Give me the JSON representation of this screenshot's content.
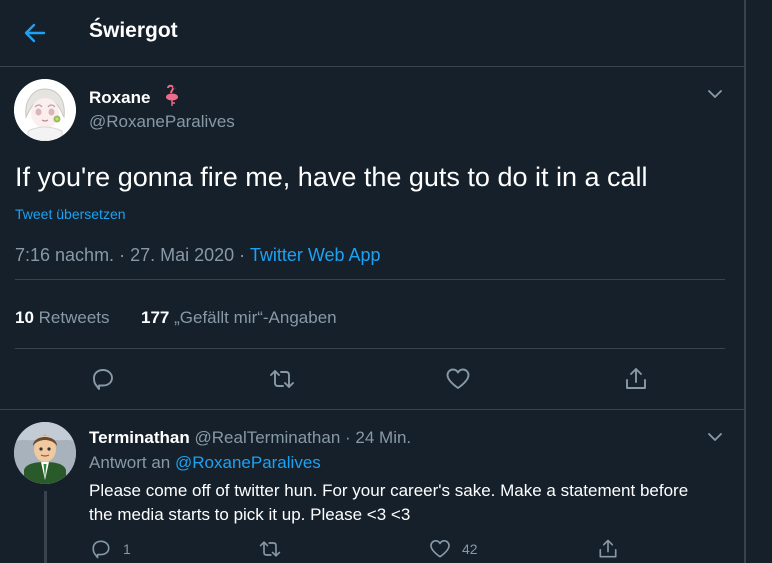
{
  "header": {
    "title": "Świergot"
  },
  "tweet": {
    "author_name": "Roxane",
    "author_handle": "@RoxaneParalives",
    "text": "If you're gonna fire me, have the guts to do it in a call",
    "translate_label": "Tweet übersetzen",
    "time": "7:16 nachm.",
    "date": "27. Mai 2020",
    "app": "Twitter Web App",
    "retweets_count": "10",
    "retweets_label": "Retweets",
    "likes_count": "177",
    "likes_label": "„Gefällt mir“-Angaben"
  },
  "reply": {
    "author_name": "Terminathan",
    "author_handle": "@RealTerminathan",
    "time_ago": "24 Min.",
    "reply_prefix": "Antwort an",
    "reply_to": "@RoxaneParalives",
    "text": "Please come off of twitter hun. For your career's sake. Make a statement before the media starts to pick it up. Please <3 <3",
    "reply_count": "1",
    "like_count": "42"
  },
  "colors": {
    "accent": "#1da1f2",
    "background": "#15202b",
    "muted": "#8899a6",
    "border": "#38444d"
  },
  "icons": [
    "back-arrow",
    "flamingo",
    "chevron-down",
    "reply",
    "retweet",
    "heart",
    "share"
  ]
}
